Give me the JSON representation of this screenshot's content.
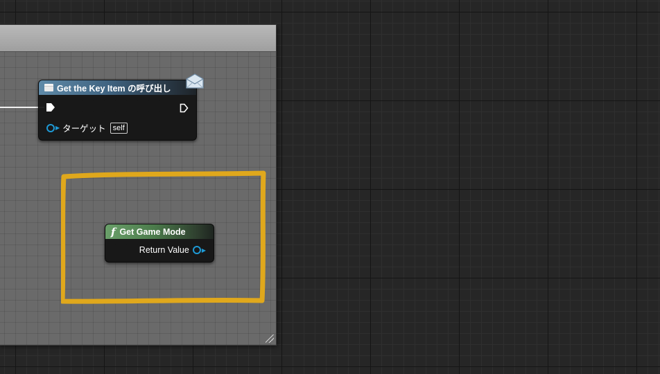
{
  "call_node": {
    "title": "Get the Key Item の呼び出し",
    "target_label": "ターゲット",
    "target_value": "self"
  },
  "func_node": {
    "title": "Get Game Mode",
    "return_label": "Return Value"
  },
  "colors": {
    "pin_object": "#1e9ad6",
    "highlight": "#e0a81c",
    "comment_header": "#a9a9a9"
  },
  "icons": [
    "event-icon",
    "envelope-icon",
    "function-icon",
    "exec-pin-icon",
    "resize-grip-icon"
  ]
}
